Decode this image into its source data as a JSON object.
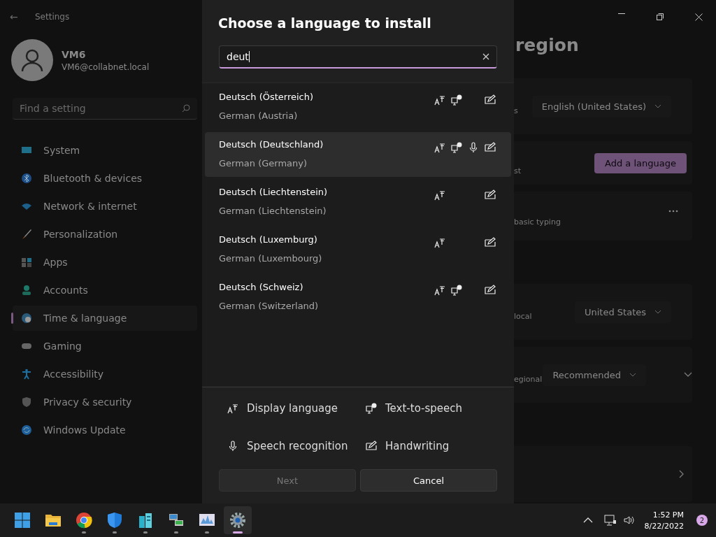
{
  "settings_window": {
    "back_button": "←",
    "title": "Settings",
    "user": {
      "name": "VM6",
      "email": "VM6@collabnet.local"
    },
    "search": {
      "placeholder": "Find a setting"
    },
    "nav_items": [
      {
        "kind": "system",
        "label": "System",
        "selected": false
      },
      {
        "kind": "bluetooth",
        "label": "Bluetooth & devices",
        "selected": false
      },
      {
        "kind": "network",
        "label": "Network & internet",
        "selected": false
      },
      {
        "kind": "personalization",
        "label": "Personalization",
        "selected": false
      },
      {
        "kind": "apps",
        "label": "Apps",
        "selected": false
      },
      {
        "kind": "accounts",
        "label": "Accounts",
        "selected": false
      },
      {
        "kind": "time",
        "label": "Time & language",
        "selected": true
      },
      {
        "kind": "gaming",
        "label": "Gaming",
        "selected": false
      },
      {
        "kind": "accessibility",
        "label": "Accessibility",
        "selected": false
      },
      {
        "kind": "privacy",
        "label": "Privacy & security",
        "selected": false
      },
      {
        "kind": "update",
        "label": "Windows Update",
        "selected": false
      }
    ],
    "page_title": "region",
    "rows": [
      {
        "kind": "dropdown",
        "label": "s",
        "value": "English (United States)"
      },
      {
        "kind": "button",
        "label": "st",
        "value": "Add a language"
      },
      {
        "kind": "more",
        "label": "basic typing"
      },
      {
        "kind": "gap"
      },
      {
        "kind": "dropdown",
        "label": "local",
        "value": "United States"
      },
      {
        "kind": "dropdown-expand",
        "label": "egional",
        "value": "Recommended"
      },
      {
        "kind": "gap"
      },
      {
        "kind": "link"
      }
    ]
  },
  "dialog": {
    "title": "Choose a language to install",
    "search": {
      "value": "deut"
    },
    "languages": [
      {
        "name": "Deutsch (Österreich)",
        "english": "German (Austria)",
        "selected": false,
        "display": true,
        "tts": true,
        "speech": false,
        "handwriting": true
      },
      {
        "name": "Deutsch (Deutschland)",
        "english": "German (Germany)",
        "selected": true,
        "display": true,
        "tts": true,
        "speech": true,
        "handwriting": true
      },
      {
        "name": "Deutsch (Liechtenstein)",
        "english": "German (Liechtenstein)",
        "selected": false,
        "display": true,
        "tts": false,
        "speech": false,
        "handwriting": true
      },
      {
        "name": "Deutsch (Luxemburg)",
        "english": "German (Luxembourg)",
        "selected": false,
        "display": true,
        "tts": false,
        "speech": false,
        "handwriting": true
      },
      {
        "name": "Deutsch (Schweiz)",
        "english": "German (Switzerland)",
        "selected": false,
        "display": true,
        "tts": true,
        "speech": false,
        "handwriting": true
      }
    ],
    "legend": [
      {
        "kind": "display",
        "label": "Display language"
      },
      {
        "kind": "tts",
        "label": "Text-to-speech"
      },
      {
        "kind": "speech",
        "label": "Speech recognition"
      },
      {
        "kind": "handwriting",
        "label": "Handwriting"
      }
    ],
    "buttons": [
      {
        "label": "Next",
        "disabled": true
      },
      {
        "label": "Cancel",
        "disabled": false
      }
    ]
  },
  "taskbar": {
    "apps": [
      {
        "kind": "start",
        "running": false,
        "selected": false
      },
      {
        "kind": "folder",
        "running": false,
        "selected": false
      },
      {
        "kind": "browser",
        "running": true,
        "selected": false
      },
      {
        "kind": "shield",
        "running": true,
        "selected": false
      },
      {
        "kind": "buildings",
        "running": true,
        "selected": false
      },
      {
        "kind": "network",
        "running": true,
        "selected": false
      },
      {
        "kind": "chart",
        "running": true,
        "selected": false
      },
      {
        "kind": "gear",
        "running": true,
        "selected": true
      }
    ],
    "time": "1:52 PM",
    "date": "8/22/2022",
    "notification_count": "2"
  }
}
